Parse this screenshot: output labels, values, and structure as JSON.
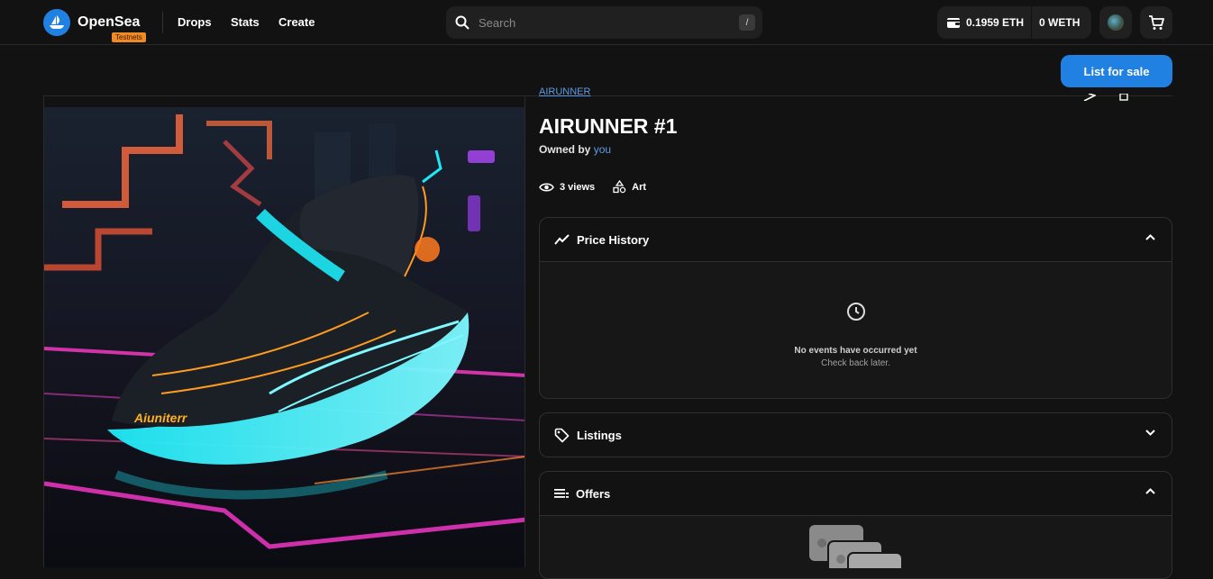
{
  "nav": {
    "brand": "OpenSea",
    "testnet_badge": "Testnets",
    "links": [
      "Drops",
      "Stats",
      "Create"
    ],
    "search_placeholder": "Search",
    "search_shortcut": "/",
    "wallet_eth": "0.1959 ETH",
    "wallet_weth": "0 WETH"
  },
  "actions": {
    "list_for_sale": "List for sale"
  },
  "item": {
    "collection": "AIRUNNER",
    "title": "AIRUNNER #1",
    "owned_by_label": "Owned by",
    "owner": "you",
    "views": "3 views",
    "category": "Art",
    "image_text": "Aiuniterr"
  },
  "panels": {
    "price_history": {
      "label": "Price History",
      "empty_title": "No events have occurred yet",
      "empty_sub": "Check back later."
    },
    "listings": {
      "label": "Listings"
    },
    "offers": {
      "label": "Offers"
    }
  },
  "colors": {
    "accent": "#2081e2",
    "link": "#5c9ce6",
    "background": "#121212",
    "panel_border": "#2f2f2f"
  }
}
